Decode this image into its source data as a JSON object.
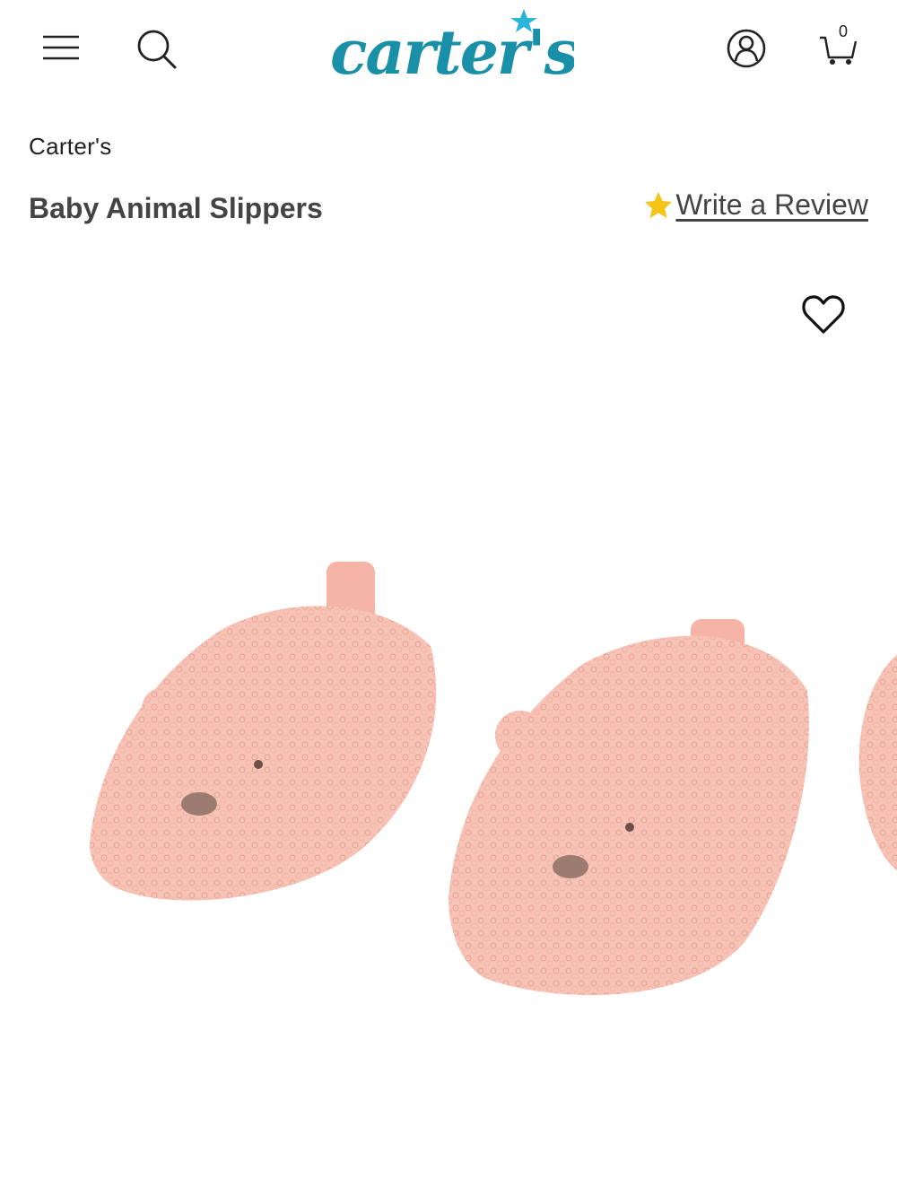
{
  "header": {
    "logo_text": "carter's",
    "cart_count": "0",
    "icons": [
      "menu-icon",
      "search-icon",
      "account-icon",
      "cart-icon"
    ]
  },
  "product": {
    "brand": "Carter's",
    "title": "Baby Animal Slippers",
    "review_link": "Write a Review",
    "wishlist_icon": "heart-icon"
  },
  "colors": {
    "brand_teal": "#1a8fa8",
    "star": "#f5c518",
    "slipper_pink": "#f7c3b6"
  }
}
